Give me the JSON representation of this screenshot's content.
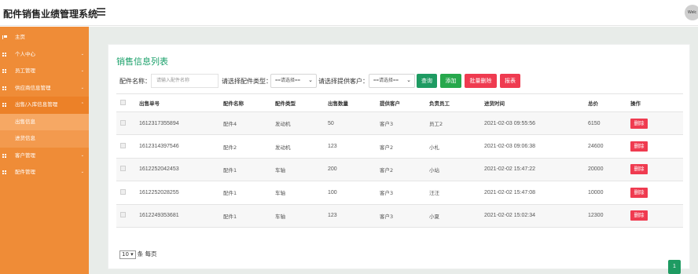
{
  "app": {
    "title": "配件销售业绩管理系统",
    "avatar_text": "Welc"
  },
  "sidebar": {
    "items": [
      {
        "label": "主页",
        "icon": "flag-icon"
      },
      {
        "label": "个人中心",
        "icon": "grid-icon"
      },
      {
        "label": "员工管理",
        "icon": "grid-icon"
      },
      {
        "label": "供应商信息管理",
        "icon": "grid-icon"
      },
      {
        "label": "出售/入库信息管理",
        "icon": "grid-icon"
      },
      {
        "label": "出售信息"
      },
      {
        "label": "进货信息"
      },
      {
        "label": "客户管理",
        "icon": "grid-icon"
      },
      {
        "label": "配件管理",
        "icon": "grid-icon"
      }
    ]
  },
  "content": {
    "title": "销售信息列表",
    "filters": {
      "name_label": "配件名称：",
      "name_placeholder": "请输入配件名称",
      "type_label": "请选择配件类型：",
      "type_value": "==请选择==",
      "customer_label": "请选择提供客户：",
      "customer_value": "==请选择=="
    },
    "buttons": {
      "query": "查询",
      "add": "添加",
      "batch_delete": "批量删除",
      "report": "报表"
    },
    "table": {
      "headers": [
        "出售单号",
        "配件名称",
        "配件类型",
        "出售数量",
        "提供客户",
        "负责员工",
        "进货时间",
        "总价",
        "操作"
      ],
      "rows": [
        {
          "id": "1612317355894",
          "name": "配件4",
          "type": "发动机",
          "qty": "50",
          "customer": "客户3",
          "staff": "员工2",
          "time": "2021-02-03 09:55:56",
          "total": "6150",
          "action": "删除"
        },
        {
          "id": "1612314397546",
          "name": "配件2",
          "type": "发动机",
          "qty": "123",
          "customer": "客户2",
          "staff": "小札",
          "time": "2021-02-03 09:06:38",
          "total": "24600",
          "action": "删除"
        },
        {
          "id": "1612252042453",
          "name": "配件1",
          "type": "车轴",
          "qty": "200",
          "customer": "客户2",
          "staff": "小站",
          "time": "2021-02-02 15:47:22",
          "total": "20000",
          "action": "删除"
        },
        {
          "id": "1612252028255",
          "name": "配件1",
          "type": "车轴",
          "qty": "100",
          "customer": "客户3",
          "staff": "汪汪",
          "time": "2021-02-02 15:47:08",
          "total": "10000",
          "action": "删除"
        },
        {
          "id": "1612249353681",
          "name": "配件1",
          "type": "车轴",
          "qty": "123",
          "customer": "客户3",
          "staff": "小夏",
          "time": "2021-02-02 15:02:34",
          "total": "12300",
          "action": "删除"
        }
      ]
    },
    "pagination": {
      "page_size": "10",
      "per_page_text": "条 每页",
      "current_page": "1"
    }
  },
  "colors": {
    "sidebar": "#ef8c37",
    "accent_green": "#1e9b62",
    "danger_red": "#ef3b50",
    "page_bg": "#e8ece9"
  }
}
